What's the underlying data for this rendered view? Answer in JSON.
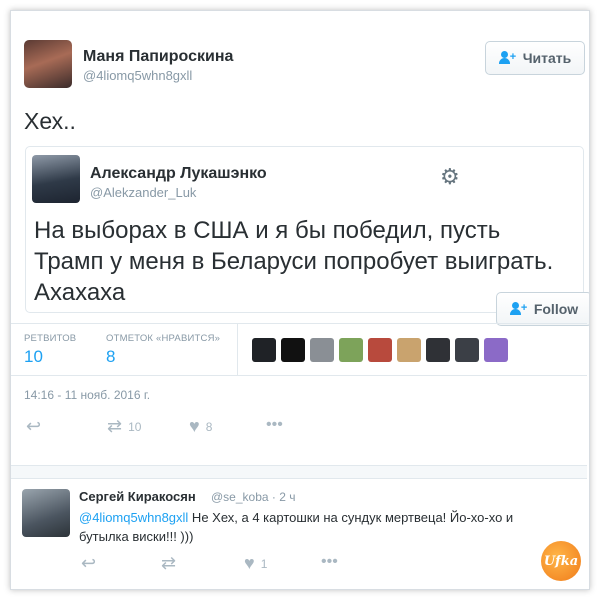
{
  "tweet": {
    "author_name": "Маня Папироскина",
    "author_handle": "@4liomq5whn8gxll",
    "follow_label": "Читать",
    "text": "Хех..",
    "timestamp": "14:16 - 11 нояб. 2016 г."
  },
  "quoted": {
    "author_name": "Александр Лукашэнко",
    "author_handle": "@Alekzander_Luk",
    "follow_label": "Follow",
    "text": "На выборах в США и я бы победил, пусть Трамп у меня в Беларуси попробует выиграть. Ахахаха"
  },
  "stats": {
    "retweets_label": "РЕТВИТОВ",
    "retweets_value": "10",
    "likes_label": "ОТМЕТОК «НРАВИТСЯ»",
    "likes_value": "8"
  },
  "actions": {
    "retweet_count": "10",
    "like_count": "8"
  },
  "reply": {
    "author_name": "Сергей Киракосян",
    "author_handle": "@se_koba",
    "time": "· 2 ч",
    "mention": "@4liomq5whn8gxll",
    "text": " Не Хех, а 4 картошки на сундук мертвеца! Йо-хо-хо и бутылка виски!!! )))",
    "like_count": "1"
  },
  "watermark": {
    "logo_text": "Ufka"
  },
  "colors": {
    "accent": "#1da1f2",
    "muted": "#8899a6",
    "text": "#292f33"
  },
  "icons": [
    "follow-person-icon",
    "gear-icon",
    "reply-icon",
    "retweet-icon",
    "heart-icon",
    "more-icon"
  ]
}
